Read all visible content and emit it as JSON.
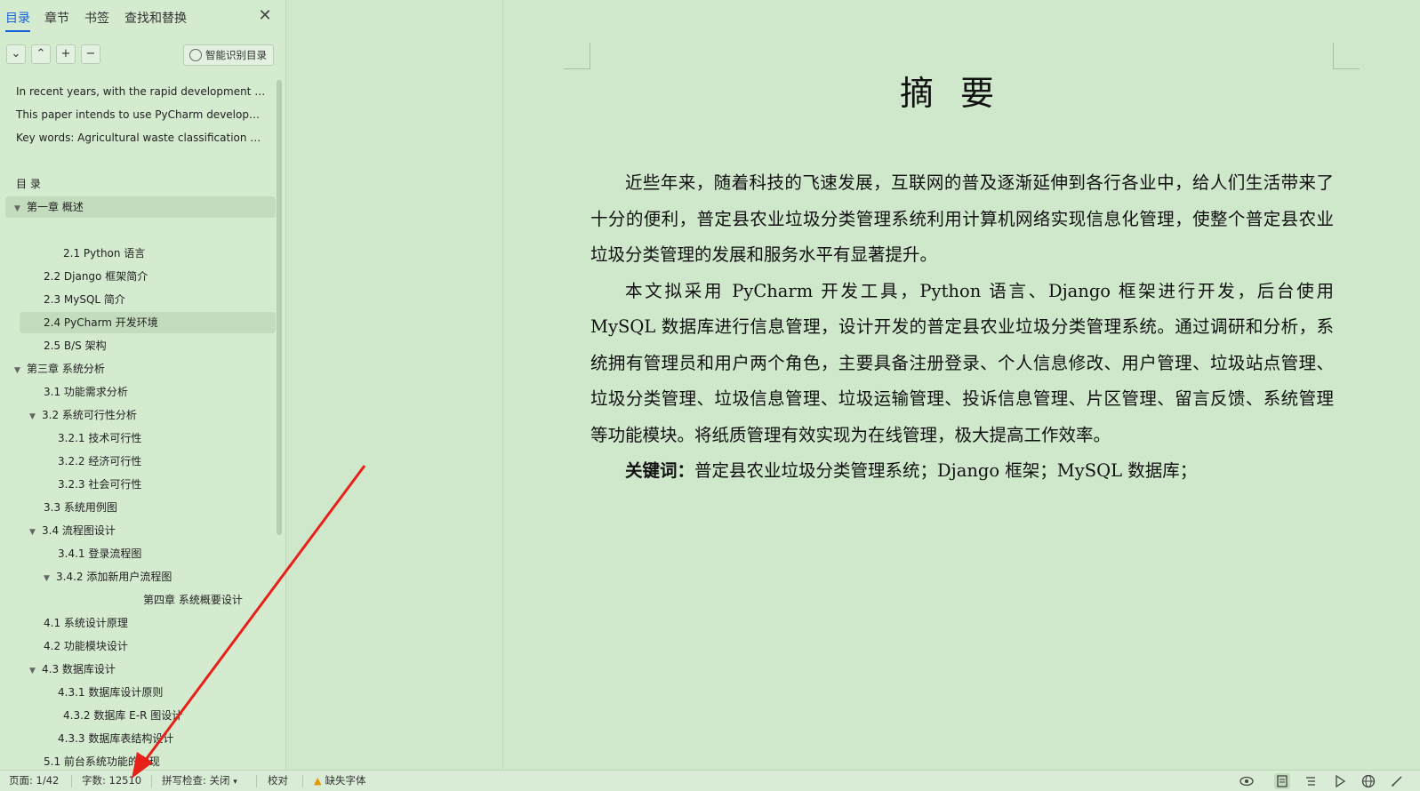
{
  "sidebar": {
    "tabs": [
      "目录",
      "章节",
      "书签",
      "查找和替换"
    ],
    "smart_toc_label": "智能识别目录",
    "toc": [
      {
        "label": "In recent years, with the rapid development …",
        "caret": ""
      },
      {
        "label": "This paper intends to use PyCharm develop…",
        "caret": ""
      },
      {
        "label": "Key words: Agricultural waste classification …",
        "caret": ""
      },
      {
        "label": "目  录",
        "caret": ""
      },
      {
        "label": "第一章 概述",
        "caret": "▼"
      },
      {
        "label": "2.1 Python 语言",
        "caret": ""
      },
      {
        "label": "2.2 Django 框架简介",
        "caret": ""
      },
      {
        "label": "2.3 MySQL 简介",
        "caret": ""
      },
      {
        "label": "2.4 PyCharm 开发环境",
        "caret": ""
      },
      {
        "label": "2.5 B/S 架构",
        "caret": ""
      },
      {
        "label": "第三章 系统分析",
        "caret": "▼"
      },
      {
        "label": "3.1 功能需求分析",
        "caret": ""
      },
      {
        "label": "3.2 系统可行性分析",
        "caret": "▼"
      },
      {
        "label": "3.2.1 技术可行性",
        "caret": ""
      },
      {
        "label": "3.2.2  经济可行性",
        "caret": ""
      },
      {
        "label": "3.2.3 社会可行性",
        "caret": ""
      },
      {
        "label": "3.3 系统用例图",
        "caret": ""
      },
      {
        "label": "3.4 流程图设计",
        "caret": "▼"
      },
      {
        "label": "3.4.1  登录流程图",
        "caret": ""
      },
      {
        "label": "3.4.2  添加新用户流程图",
        "caret": "▼"
      },
      {
        "label": "第四章  系统概要设计",
        "caret": ""
      },
      {
        "label": "4.1 系统设计原理",
        "caret": ""
      },
      {
        "label": "4.2 功能模块设计",
        "caret": ""
      },
      {
        "label": "4.3  数据库设计",
        "caret": "▼"
      },
      {
        "label": "4.3.1 数据库设计原则",
        "caret": ""
      },
      {
        "label": "4.3.2 数据库 E-R 图设计",
        "caret": ""
      },
      {
        "label": "4.3.3 数据库表结构设计",
        "caret": ""
      },
      {
        "label": "5.1 前台系统功能的实现",
        "caret": ""
      }
    ]
  },
  "document": {
    "title": "摘要",
    "paragraphs": [
      "近些年来，随着科技的飞速发展，互联网的普及逐渐延伸到各行各业中，给人们生活带来了十分的便利，普定县农业垃圾分类管理系统利用计算机网络实现信息化管理，使整个普定县农业垃圾分类管理的发展和服务水平有显著提升。",
      "本文拟采用 PyCharm 开发工具，Python 语言、Django 框架进行开发，后台使用 MySQL 数据库进行信息管理，设计开发的普定县农业垃圾分类管理系统。通过调研和分析，系统拥有管理员和用户两个角色，主要具备注册登录、个人信息修改、用户管理、垃圾站点管理、垃圾分类管理、垃圾信息管理、垃圾运输管理、投诉信息管理、片区管理、留言反馈、系统管理等功能模块。将纸质管理有效实现为在线管理，极大提高工作效率。"
    ],
    "keywords_label": "关键词：",
    "keywords_text": "普定县农业垃圾分类管理系统；Django 框架；MySQL 数据库；"
  },
  "statusbar": {
    "page": "页面: 1/42",
    "wordcount": "字数: 12510",
    "spellcheck": "拼写检查: 关闭",
    "proofread": "校对",
    "missing_fonts": "缺失字体"
  },
  "colors": {
    "background": "#cfe8cb",
    "accent": "#1a63d6",
    "arrow": "#e8201a"
  }
}
